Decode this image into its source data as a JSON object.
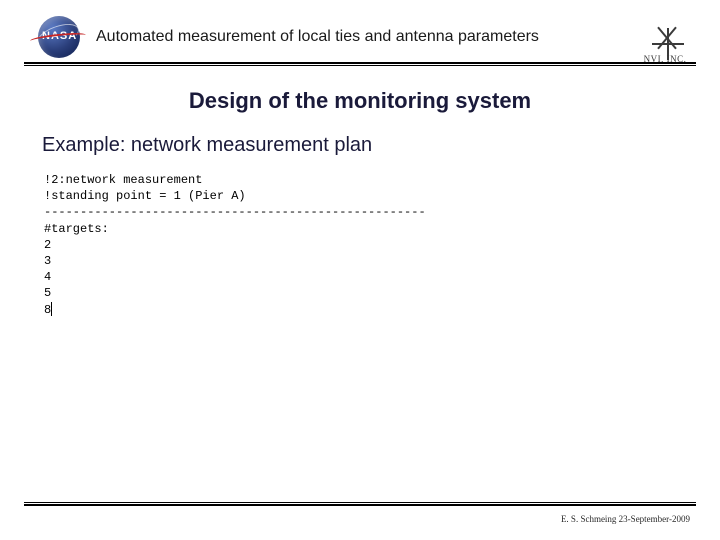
{
  "header": {
    "nasa_label": "NASA",
    "title": "Automated measurement of local ties and antenna parameters",
    "nvi_label": "NVI, INC."
  },
  "section_title": "Design of the monitoring system",
  "subtitle": "Example: network measurement plan",
  "code": {
    "l1": "!2:network measurement",
    "l2": "!standing point = 1 (Pier A)",
    "l3": "-----------------------------------------------------",
    "l4": "#targets:",
    "l5": "2",
    "l6": "3",
    "l7": "4",
    "l8": "5",
    "l9": "8"
  },
  "footer": "E. S. Schmeing 23-September-2009"
}
